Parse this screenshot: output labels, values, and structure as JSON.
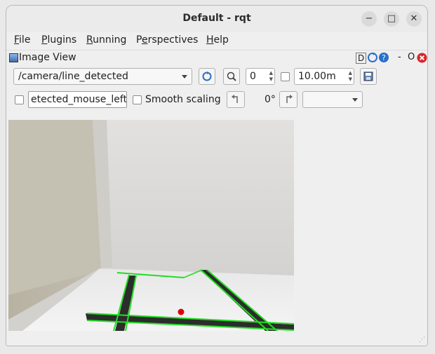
{
  "window": {
    "title": "Default - rqt",
    "controls": [
      "−",
      "□",
      "✕"
    ]
  },
  "menubar": [
    {
      "label": "File",
      "mnemonic": "F",
      "rest": "ile"
    },
    {
      "label": "Plugins",
      "mnemonic": "P",
      "rest": "lugins"
    },
    {
      "label": "Running",
      "mnemonic": "R",
      "rest": "unning"
    },
    {
      "label": "Perspectives",
      "pre": "P",
      "mnemonic": "e",
      "rest": "rspectives"
    },
    {
      "label": "Help",
      "mnemonic": "H",
      "rest": "elp"
    }
  ],
  "dock": {
    "title": "Image View",
    "controls": {
      "d": "D",
      "refresh_icon": "refresh-icon",
      "help_icon": "help-icon",
      "minimize": "-",
      "float": "O",
      "close_icon": "close-icon"
    }
  },
  "toolbar": {
    "topic": "/camera/line_detected",
    "refresh_icon": "refresh-icon",
    "zoom_icon": "zoom-icon",
    "spin_value": "0",
    "max_value": "10.00m",
    "save_icon": "save-icon",
    "mouse_topic": "etected_mouse_left",
    "smooth_scaling_label": "Smooth scaling",
    "rotate_left_icon": "rotate-left-icon",
    "rotation": "0°",
    "rotate_right_icon": "rotate-right-icon",
    "color_scheme": ""
  },
  "colors": {
    "line": "#22dd22",
    "dot": "#e00000",
    "tape": "#2a2a2a"
  }
}
